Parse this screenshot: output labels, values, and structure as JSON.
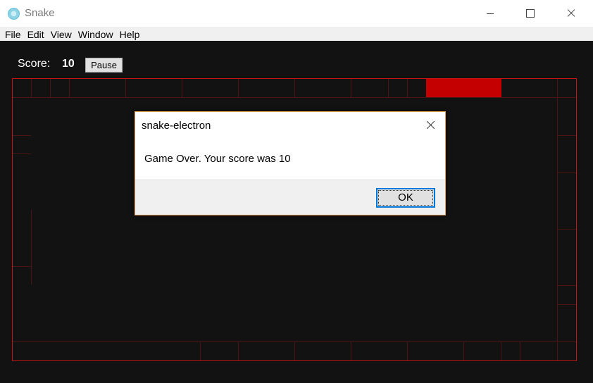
{
  "window": {
    "title": "Snake",
    "icon": "electron-app-icon"
  },
  "menu": {
    "items": [
      "File",
      "Edit",
      "View",
      "Window",
      "Help"
    ]
  },
  "game": {
    "score_label": "Score:",
    "score_value": "10",
    "pause_label": "Pause",
    "colors": {
      "background": "#121212",
      "border": "#c41414",
      "food": "#c50000"
    }
  },
  "dialog": {
    "title": "snake-electron",
    "message": "Game Over. Your score was 10",
    "ok_label": "OK"
  }
}
